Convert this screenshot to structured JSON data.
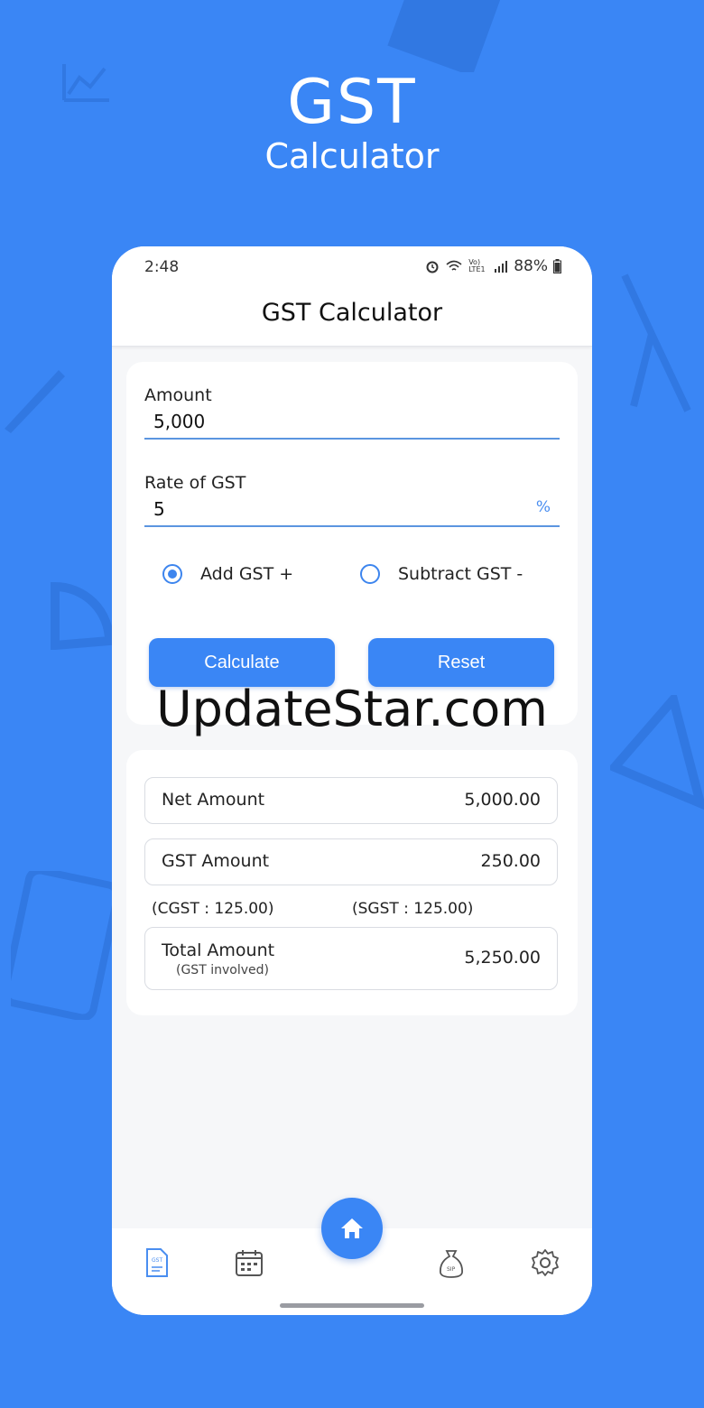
{
  "hero": {
    "title": "GST",
    "subtitle": "Calculator"
  },
  "status": {
    "time": "2:48",
    "network": "Vo) LTE1",
    "battery": "88%"
  },
  "appbar": {
    "title": "GST Calculator"
  },
  "form": {
    "amount_label": "Amount",
    "amount_value": "5,000",
    "rate_label": "Rate of GST",
    "rate_value": "5",
    "rate_unit": "%",
    "options": [
      {
        "label": "Add GST +",
        "selected": true
      },
      {
        "label": "Subtract GST -",
        "selected": false
      }
    ],
    "calculate_label": "Calculate",
    "reset_label": "Reset"
  },
  "watermark": "UpdateStar.com",
  "results": {
    "net_label": "Net Amount",
    "net_value": "5,000.00",
    "gst_label": "GST Amount",
    "gst_value": "250.00",
    "cgst": "(CGST : 125.00)",
    "sgst": "(SGST : 125.00)",
    "total_label": "Total Amount",
    "total_sub": "(GST involved)",
    "total_value": "5,250.00"
  },
  "nav": {
    "items": [
      "gst-doc-icon",
      "calendar-icon",
      "home-icon",
      "sip-bag-icon",
      "gear-icon"
    ],
    "sip_text": "SIP",
    "gst_text": "GST"
  },
  "colors": {
    "brand": "#3a86f5",
    "accent_line": "#5b95e0",
    "background": "#f6f7f9"
  }
}
